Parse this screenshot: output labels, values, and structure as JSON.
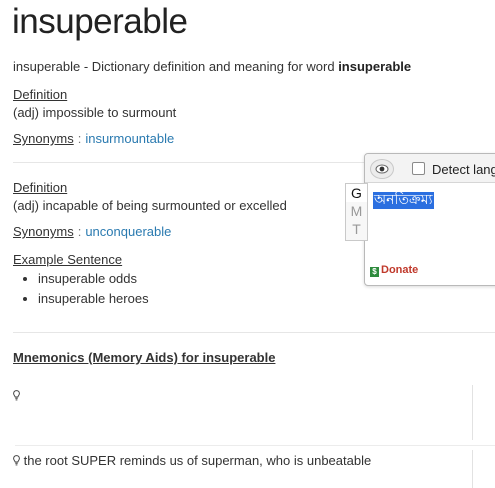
{
  "page": {
    "title": "insuperable",
    "subtitle_prefix": "insuperable - Dictionary definition and meaning for word ",
    "subtitle_word": "insuperable"
  },
  "sense1": {
    "definition_label": "Definition",
    "definition": "(adj) impossible to surmount",
    "synonyms_label": "Synonyms",
    "colon": ":",
    "synonym": "insurmountable"
  },
  "sense2": {
    "definition_label": "Definition",
    "definition": "(adj) incapable of being surmounted or excelled",
    "synonyms_label": "Synonyms",
    "colon": ":",
    "synonym": "unconquerable",
    "example_label": "Example Sentence",
    "examples": [
      "insuperable odds",
      "insuperable heroes"
    ]
  },
  "mnemonics": {
    "title": "Mnemonics (Memory Aids) for insuperable",
    "item2": "the root SUPER reminds us of superman, who is unbeatable"
  },
  "popup": {
    "detect_label": "Detect lang",
    "translation": "অনতিক্রম্য",
    "donate": "Donate",
    "gmt": [
      "G",
      "M",
      "T"
    ]
  }
}
